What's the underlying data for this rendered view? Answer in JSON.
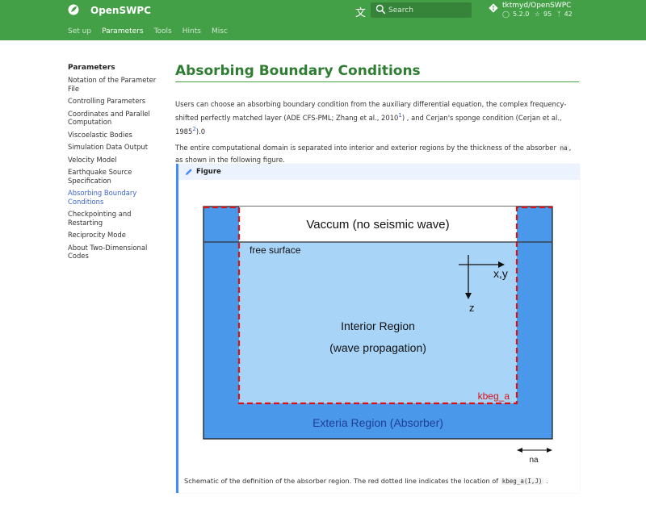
{
  "header": {
    "site_title": "OpenSWPC",
    "search_placeholder": "Search",
    "repo_name": "tktmyd/OpenSWPC",
    "repo_version": "5.2.0",
    "repo_stars": "95",
    "repo_forks": "42",
    "tabs": [
      {
        "label": "Set up"
      },
      {
        "label": "Parameters"
      },
      {
        "label": "Tools"
      },
      {
        "label": "Hints"
      },
      {
        "label": "Misc"
      }
    ],
    "colors": {
      "primary": "#43a047"
    }
  },
  "sidebar": {
    "title": "Parameters",
    "items": [
      {
        "label": "Notation of the Parameter File"
      },
      {
        "label": "Controlling Parameters"
      },
      {
        "label": "Coordinates and Parallel Computation"
      },
      {
        "label": "Viscoelastic Bodies"
      },
      {
        "label": "Simulation Data Output"
      },
      {
        "label": "Velocity Model"
      },
      {
        "label": "Earthquake Source Specification"
      },
      {
        "label": "Absorbing Boundary Conditions"
      },
      {
        "label": "Checkpointing and Restarting"
      },
      {
        "label": "Reciprocity Mode"
      },
      {
        "label": "About Two-Dimensional Codes"
      }
    ]
  },
  "main": {
    "title": "Absorbing Boundary Conditions",
    "p1_a": "Users can choose an absorbing boundary condition from the auxiliary differential equation, the complex frequency-shifted perfectly matched layer (ADE CFS-PML; Zhang et al., 2010",
    "p1_ref1": "1",
    "p1_b": ") , and Cerjan's sponge condition (Cerjan et al., 1985",
    "p1_ref2": "2",
    "p1_c": ").0",
    "p2_a": "The entire computational domain is separated into interior and exterior regions by the thickness of the absorber ",
    "p2_code": "na",
    "p2_b": ", as shown in the following figure.",
    "figure": {
      "title": "Figure",
      "vaccum_label": "Vaccum (no seismic wave)",
      "free_surface": "free surface",
      "xy_label": "x,y",
      "z_label": "z",
      "interior_1": "Interior Region",
      "interior_2": "(wave propagation)",
      "kbeg_label": "kbeg_a",
      "exterior_label": "Exteria Region (Absorber)",
      "na_label": "na",
      "colors": {
        "absorber": "#4a98ea",
        "interior": "#a8d4f8",
        "boundary": "#dd1111",
        "exterior_text": "#1e3f96"
      }
    },
    "caption_a": "Schematic of the definition of the absorber region. The red dotted line indicates the location of ",
    "caption_code": "kbeg_a(I,J)",
    "caption_b": " ."
  }
}
